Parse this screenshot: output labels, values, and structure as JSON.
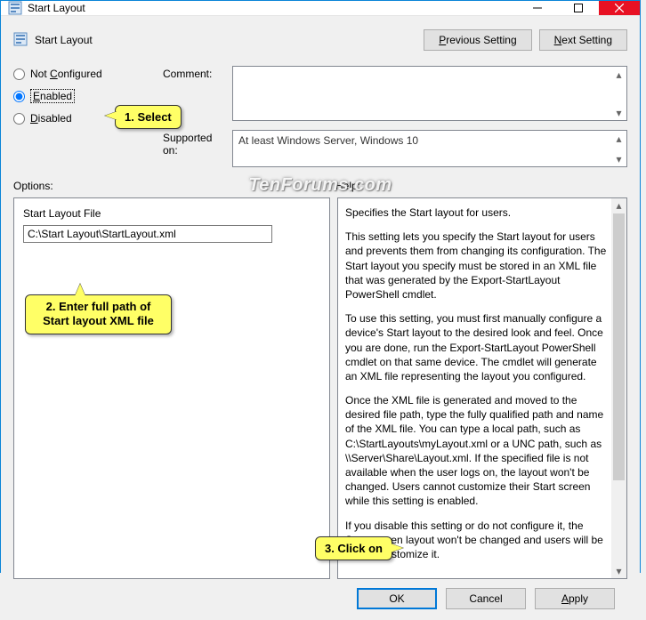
{
  "title": "Start Layout",
  "header": {
    "heading": "Start Layout",
    "prev_prefix": "P",
    "prev_rest": "revious Setting",
    "next_prefix": "N",
    "next_rest": "ext Setting"
  },
  "radios": {
    "not_conf_prefix": "Not ",
    "not_conf_und": "C",
    "not_conf_rest": "onfigured",
    "enabled_und": "E",
    "enabled_rest": "nabled",
    "disabled_und": "D",
    "disabled_rest": "isabled"
  },
  "labels": {
    "comment": "Comment:",
    "supported": "Supported on:",
    "options": "Options:",
    "help": "Help:",
    "file": "Start Layout File"
  },
  "supported_text": "At least Windows Server, Windows 10",
  "file_input_value": "C:\\Start Layout\\StartLayout.xml",
  "help": {
    "p1": "Specifies the Start layout for users.",
    "p2": "This setting lets you specify the Start layout for users and prevents them from changing its configuration. The Start layout you specify must be stored in an XML file that was generated by the Export-StartLayout PowerShell cmdlet.",
    "p3": "To use this setting, you must first manually configure a device's Start layout to the desired look and feel. Once you are done, run the Export-StartLayout PowerShell cmdlet on that same device. The cmdlet will generate an XML file representing the layout you configured.",
    "p4": "Once the XML file is generated and moved to the desired file path, type the fully qualified path and name of the XML file. You can type a local path, such as C:\\StartLayouts\\myLayout.xml or a UNC path, such as \\\\Server\\Share\\Layout.xml. If the specified file is not available when the user logs on, the layout won't be changed. Users cannot customize their Start screen while this setting is enabled.",
    "p5": "If you disable this setting or do not configure it, the Start screen layout won't be changed and users will be able to customize it."
  },
  "buttons": {
    "ok": "OK",
    "cancel": "Cancel",
    "apply_und": "A",
    "apply_rest": "pply"
  },
  "callouts": {
    "c1": "1. Select",
    "c2": "2. Enter full path of Start layout XML file",
    "c3": "3. Click on"
  },
  "watermark": "TenForums.com"
}
